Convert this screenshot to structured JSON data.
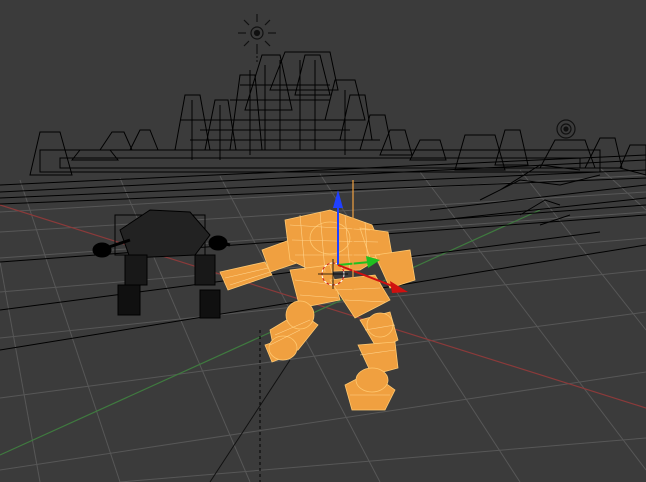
{
  "app": {
    "name": "3D Viewport",
    "mode": "wireframe"
  },
  "colors": {
    "background": "#3b3b3b",
    "grid": "#555555",
    "x_axis": "#8a3a3a",
    "y_axis": "#3f7a3f",
    "wire_unselected": "#000000",
    "selected": "#f0a040",
    "selected_outline": "#ffc060",
    "gizmo_x": "#d01010",
    "gizmo_y": "#20c020",
    "gizmo_z": "#2040ff",
    "lamp": "#ffffff"
  },
  "objects": [
    {
      "name": "city-buildings-wireframe",
      "selected": false
    },
    {
      "name": "dark-mech-wireframe",
      "selected": false
    },
    {
      "name": "orange-mech-selected",
      "selected": true
    },
    {
      "name": "sun-lamp",
      "selected": false
    },
    {
      "name": "point-lamp",
      "selected": false
    }
  ],
  "gizmo": {
    "type": "translate",
    "axes": [
      "x",
      "y",
      "z"
    ]
  }
}
